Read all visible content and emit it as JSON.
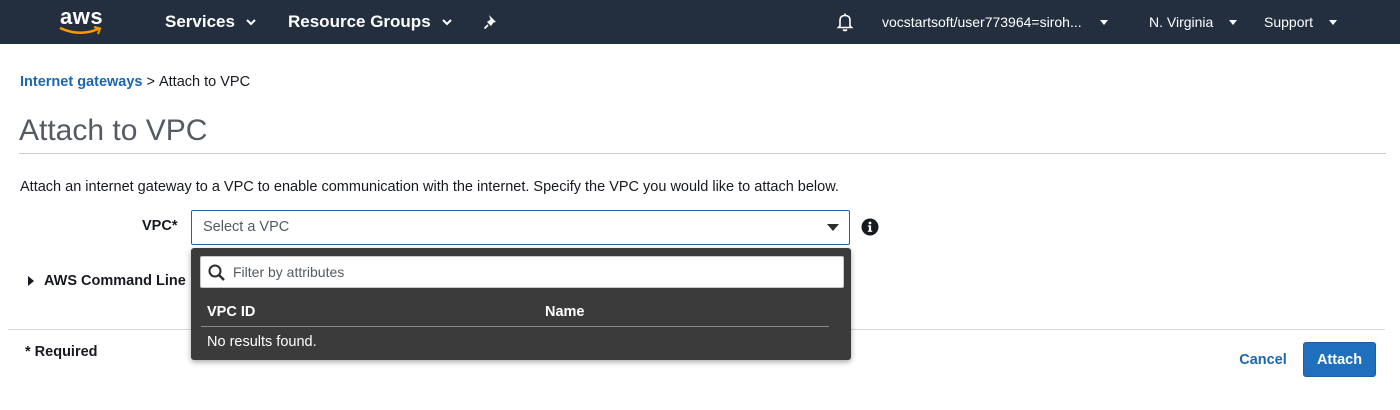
{
  "topnav": {
    "logo_text": "aws",
    "services_label": "Services",
    "resource_groups_label": "Resource Groups",
    "account_label": "vocstartsoft/user773964=siroh...",
    "region_label": "N. Virginia",
    "support_label": "Support",
    "background": "#232f3e",
    "icons": [
      "chevron-down-icon",
      "pin-icon",
      "bell-icon"
    ]
  },
  "breadcrumb": {
    "parent_label": "Internet gateways",
    "separator": ">",
    "current_label": "Attach to VPC"
  },
  "page": {
    "title": "Attach to VPC",
    "description": "Attach an internet gateway to a VPC to enable communication with the internet. Specify the VPC you would like to attach below."
  },
  "form": {
    "vpc_label": "VPC*",
    "vpc_select_value": "Select a VPC",
    "cli_toggle_label": "AWS Command Line",
    "required_note": "* Required"
  },
  "dropdown": {
    "filter_placeholder": "Filter by attributes",
    "columns": [
      "VPC ID",
      "Name"
    ],
    "empty_message": "No results found."
  },
  "actions": {
    "cancel_label": "Cancel",
    "attach_label": "Attach"
  },
  "colors": {
    "accent": "#1b66b3",
    "primary_button": "#1f6fbd",
    "dropdown_background": "#3b3b3b"
  }
}
